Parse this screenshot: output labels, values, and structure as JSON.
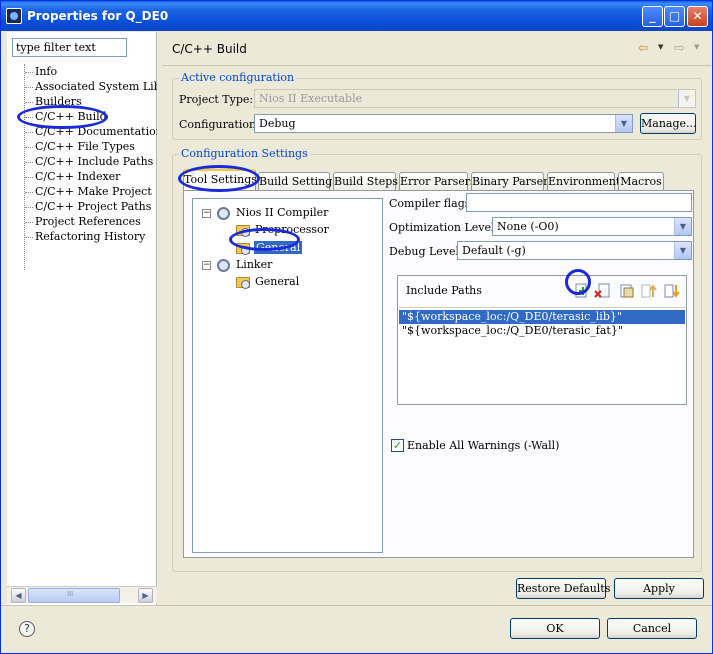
{
  "window": {
    "title": "Properties for Q_DE0",
    "minimize": "_",
    "maximize": "□",
    "close": "✕"
  },
  "sidebar": {
    "filter_placeholder": "type filter text",
    "items": [
      {
        "label": "Info"
      },
      {
        "label": "Associated System Library"
      },
      {
        "label": "Builders"
      },
      {
        "label": "C/C++ Build"
      },
      {
        "label": "C/C++ Documentation"
      },
      {
        "label": "C/C++ File Types"
      },
      {
        "label": "C/C++ Include Paths and"
      },
      {
        "label": "C/C++ Indexer"
      },
      {
        "label": "C/C++ Make Project"
      },
      {
        "label": "C/C++ Project Paths"
      },
      {
        "label": "Project References"
      },
      {
        "label": "Refactoring History"
      }
    ],
    "scroll_left": "◀",
    "scroll_right": "▶",
    "scroll_grip": "III"
  },
  "header": {
    "title": "C/C++ Build",
    "back_icon": "⇦",
    "forward_icon": "⇨",
    "dropdown": "▼"
  },
  "active_config": {
    "legend": "Active configuration",
    "project_type_label": "Project Type:",
    "project_type_value": "Nios II Executable",
    "configuration_label": "Configuration:",
    "configuration_value": "Debug",
    "manage_button": "Manage...",
    "arrow": "▼"
  },
  "config_settings": {
    "legend": "Configuration Settings",
    "tabs": [
      {
        "label": "Tool Settings",
        "active": true
      },
      {
        "label": "Build Settings"
      },
      {
        "label": "Build Steps"
      },
      {
        "label": "Error Parsers"
      },
      {
        "label": "Binary Parser"
      },
      {
        "label": "Environment"
      },
      {
        "label": "Macros"
      }
    ],
    "tool_tree": {
      "nodes": [
        {
          "label": "Nios II Compiler",
          "expander": "−"
        },
        {
          "label": "Preprocessor"
        },
        {
          "label": "General",
          "selected": true
        },
        {
          "label": "Linker",
          "expander": "−"
        },
        {
          "label": "General"
        }
      ]
    },
    "compiler_flags_label": "Compiler flags",
    "compiler_flags_value": "",
    "optimization_label": "Optimization Levels",
    "optimization_value": "None (-O0)",
    "debug_label": "Debug Level",
    "debug_value": "Default (-g)",
    "include_paths": {
      "title": "Include Paths",
      "toolbar_icons": [
        "add-icon",
        "delete-icon",
        "edit-icon",
        "move-up-icon",
        "move-down-icon"
      ],
      "items": [
        {
          "path": "\"${workspace_loc:/Q_DE0/terasic_lib}\"",
          "selected": true
        },
        {
          "path": "\"${workspace_loc:/Q_DE0/terasic_fat}\""
        }
      ]
    },
    "warnings_checkbox_label": "Enable All Warnings (-Wall)",
    "warnings_checked": true,
    "check_mark": "✓"
  },
  "buttons": {
    "restore_defaults": "Restore Defaults",
    "apply": "Apply",
    "ok": "OK",
    "cancel": "Cancel",
    "help": "?"
  },
  "colors": {
    "titlebar": "#0a4fd8",
    "selection": "#316ac5",
    "legend": "#0046d5",
    "annotation": "#1a2ad8"
  }
}
